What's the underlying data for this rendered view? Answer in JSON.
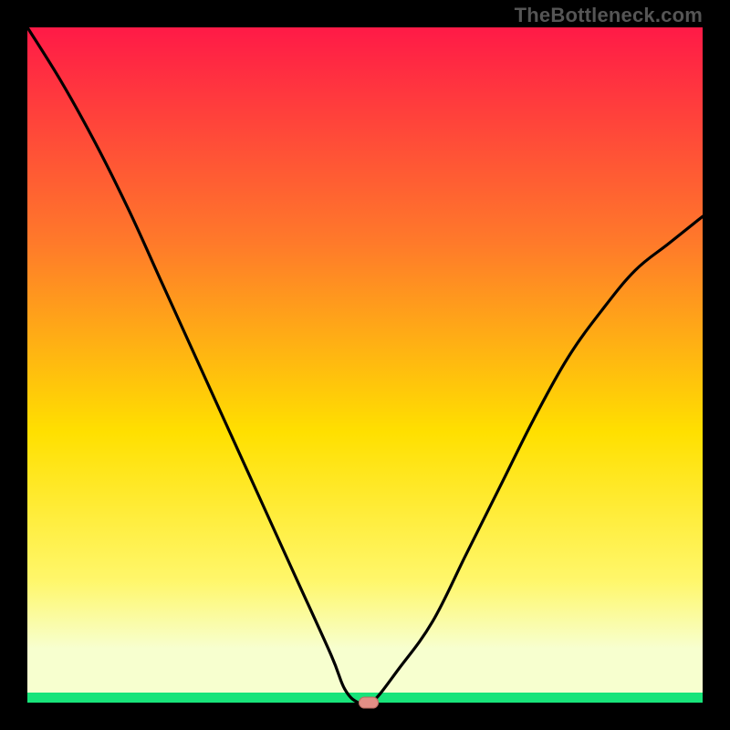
{
  "watermark": "TheBottleneck.com",
  "colors": {
    "top": "#ff1a47",
    "mid_upper": "#ff7a2a",
    "mid": "#ffe000",
    "mid_lower": "#fff76b",
    "band": "#f7ffcf",
    "bottom": "#18e47a",
    "curve": "#000000",
    "frame": "#000000",
    "marker_fill": "#e28f86",
    "marker_stroke": "#b76a5f"
  },
  "chart_data": {
    "type": "line",
    "title": "",
    "xlabel": "",
    "ylabel": "",
    "xlim": [
      0,
      100
    ],
    "ylim": [
      0,
      100
    ],
    "x": [
      0,
      5,
      10,
      15,
      20,
      25,
      30,
      35,
      40,
      45,
      47,
      49,
      51,
      55,
      60,
      65,
      70,
      75,
      80,
      85,
      90,
      95,
      100
    ],
    "y": [
      100,
      92,
      83,
      73,
      62,
      51,
      40,
      29,
      18,
      7,
      2,
      0,
      0,
      5,
      12,
      22,
      32,
      42,
      51,
      58,
      64,
      68,
      72
    ],
    "marker": {
      "x": 50.5,
      "y": 0
    },
    "watermark": "TheBottleneck.com"
  }
}
